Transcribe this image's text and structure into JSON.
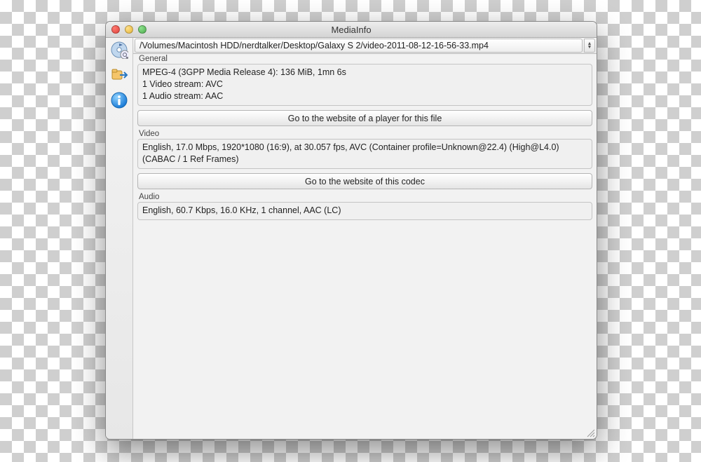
{
  "window": {
    "title": "MediaInfo"
  },
  "file_path": "/Volumes/Macintosh HDD/nerdtalker/Desktop/Galaxy S 2/video-2011-08-12-16-56-33.mp4",
  "sections": {
    "general": {
      "label": "General",
      "line1": "MPEG-4 (3GPP Media Release 4): 136 MiB, 1mn 6s",
      "line2": "1 Video stream: AVC",
      "line3": "1 Audio stream: AAC",
      "button": "Go to the website of a player for this file"
    },
    "video": {
      "label": "Video",
      "line1": "English, 17.0 Mbps, 1920*1080 (16:9), at 30.057 fps, AVC (Container profile=Unknown@22.4) (High@L4.0) (CABAC / 1 Ref Frames)",
      "button": "Go to the website of this codec"
    },
    "audio": {
      "label": "Audio",
      "line1": "English, 60.7 Kbps, 16.0 KHz, 1 channel, AAC (LC)"
    }
  },
  "icons": {
    "media": "media-note-icon",
    "export": "export-icon",
    "info": "info-icon"
  }
}
